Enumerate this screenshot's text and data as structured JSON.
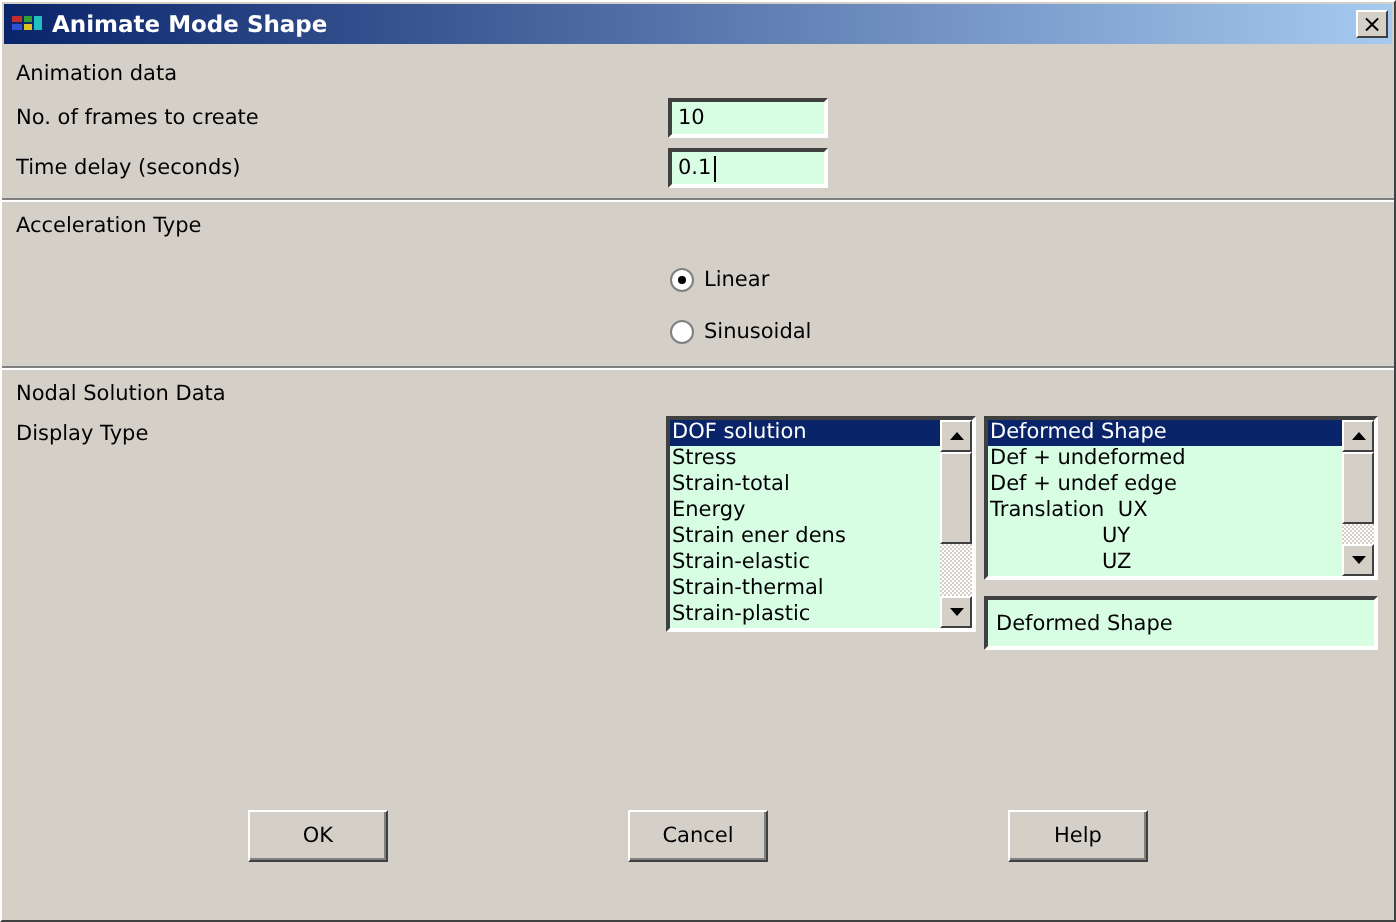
{
  "window": {
    "title": "Animate Mode Shape",
    "close": "×"
  },
  "animation": {
    "heading": "Animation data",
    "fields": [
      {
        "label": "No. of frames to create",
        "value": "10",
        "focused": false
      },
      {
        "label": "Time delay (seconds)",
        "value": "0.1",
        "focused": true
      }
    ]
  },
  "acceleration": {
    "heading": "Acceleration Type",
    "options": [
      {
        "label": "Linear",
        "selected": true
      },
      {
        "label": "Sinusoidal",
        "selected": false
      }
    ]
  },
  "nodal": {
    "heading": "Nodal Solution Data",
    "label": "Display Type",
    "list_1": [
      {
        "label": "DOF solution",
        "selected": true
      },
      {
        "label": "Stress",
        "selected": false
      },
      {
        "label": "Strain-total",
        "selected": false
      },
      {
        "label": "Energy",
        "selected": false
      },
      {
        "label": "Strain ener dens",
        "selected": false
      },
      {
        "label": "Strain-elastic",
        "selected": false
      },
      {
        "label": "Strain-thermal",
        "selected": false
      },
      {
        "label": "Strain-plastic",
        "selected": false
      }
    ],
    "list_2": [
      {
        "label": "Deformed Shape",
        "selected": true,
        "kind": "item"
      },
      {
        "label": "Def + undeformed",
        "selected": false,
        "kind": "item"
      },
      {
        "label": "Def + undef edge",
        "selected": false,
        "kind": "item"
      },
      {
        "label": "Translation  UX",
        "selected": false,
        "kind": "item"
      },
      {
        "label": "UY",
        "selected": false,
        "kind": "sub"
      },
      {
        "label": "UZ",
        "selected": false,
        "kind": "sub"
      }
    ],
    "selection": "Deformed Shape"
  },
  "buttons": [
    "OK",
    "Cancel",
    "Help"
  ]
}
